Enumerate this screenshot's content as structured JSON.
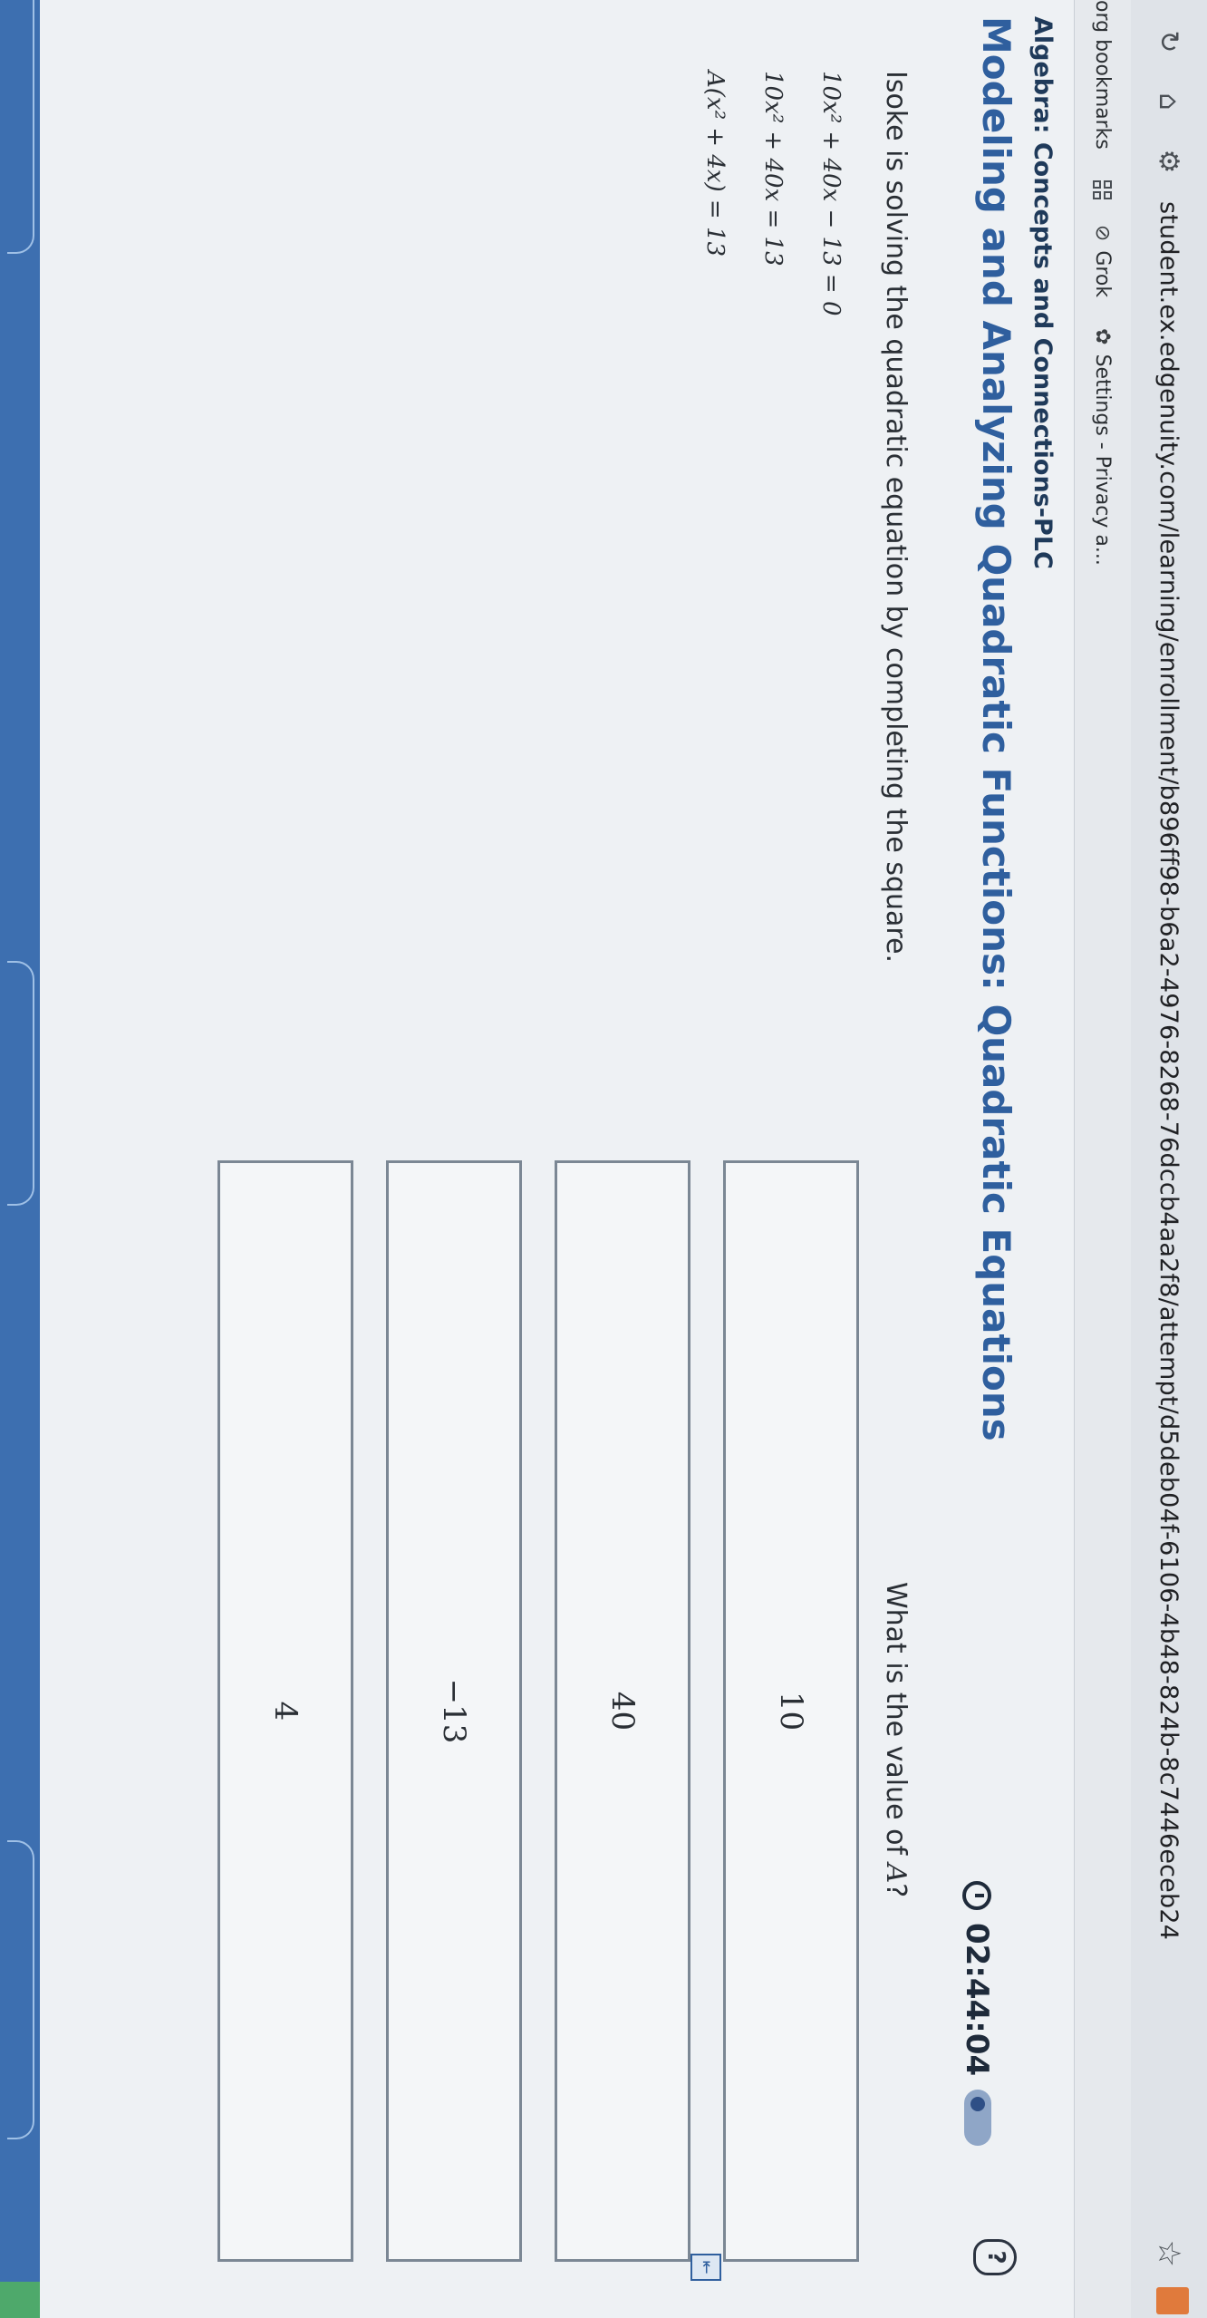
{
  "browser": {
    "url": "student.ex.edgenuity.com/learning/enrollment/b896ff98-b6a2-4976-8268-76dccb4aa2f8/attempt/d5deb04f-6106-4b48-824b-8c7446eceb24",
    "bookmarks": [
      {
        "label": "org bookmarks",
        "icon": "folder-icon"
      },
      {
        "label": "Grok",
        "icon": "grok-icon"
      },
      {
        "label": "Settings - Privacy a...",
        "icon": "gear-icon"
      }
    ]
  },
  "header": {
    "course": "Algebra: Concepts and Connections-PLC",
    "lesson": "Modeling and Analyzing Quadratic Functions: Quadratic Equations",
    "timer": "02:44:04"
  },
  "problem": {
    "prompt": "Isoke is solving the quadratic equation by completing the square.",
    "steps": [
      "10x² + 40x − 13 = 0",
      "10x² + 40x = 13",
      "A(x² + 4x) = 13"
    ],
    "question_prefix": "What is the value of ",
    "question_var": "A",
    "question_suffix": "?"
  },
  "answers": [
    {
      "label": "10"
    },
    {
      "label": "40"
    },
    {
      "label": "−13"
    },
    {
      "label": "4"
    }
  ],
  "colors": {
    "lesson_title": "#2f5f9e",
    "course_title": "#1f3a5a",
    "bottom_bar": "#3d6fb0"
  }
}
